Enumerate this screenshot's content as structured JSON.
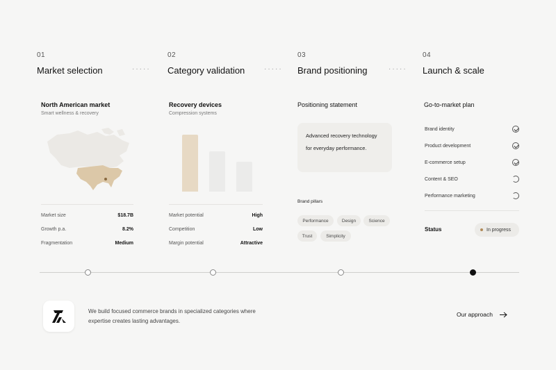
{
  "steps": [
    {
      "num": "01",
      "title": "Market selection"
    },
    {
      "num": "02",
      "title": "Category validation"
    },
    {
      "num": "03",
      "title": "Brand positioning"
    },
    {
      "num": "04",
      "title": "Launch & scale"
    }
  ],
  "dots": "·····",
  "card1": {
    "title": "North American market",
    "subtitle": "Smart wellness & recovery",
    "metrics": [
      {
        "k": "Market size",
        "v": "$18.7B"
      },
      {
        "k": "Growth p.a.",
        "v": "8.2%"
      },
      {
        "k": "Fragmentation",
        "v": "Medium"
      }
    ]
  },
  "card2": {
    "title": "Recovery devices",
    "subtitle": "Compression systems",
    "bars": [
      1.0,
      0.71,
      0.53
    ],
    "metrics": [
      {
        "k": "Market potential",
        "v": "High"
      },
      {
        "k": "Competition",
        "v": "Low"
      },
      {
        "k": "Margin potential",
        "v": "Attractive"
      }
    ]
  },
  "card3": {
    "title": "Positioning statement",
    "statement": "Advanced recovery technology for everyday performance.",
    "pillars_label": "Brand pillars",
    "pillars": [
      "Performance",
      "Design",
      "Science",
      "Trust",
      "Simplicity"
    ]
  },
  "card4": {
    "title": "Go-to-market plan",
    "items": [
      {
        "label": "Brand identity",
        "done": true
      },
      {
        "label": "Product development",
        "done": true
      },
      {
        "label": "E-commerce setup",
        "done": true
      },
      {
        "label": "Content & SEO",
        "done": false
      },
      {
        "label": "Performance marketing",
        "done": false
      }
    ],
    "status_label": "Status",
    "status_value": "In progress"
  },
  "footer": {
    "tagline": "We build focused commerce brands in specialized categories where expertise creates lasting advantages.",
    "cta": "Our approach",
    "cta_icon": "arrow-right-icon",
    "logo_icon": "brand-logo-icon"
  },
  "colors": {
    "accent": "#e7d9c4",
    "accent_dark": "#b08a58",
    "bar_light": "#ebebea",
    "background": "#f6f6f5"
  }
}
